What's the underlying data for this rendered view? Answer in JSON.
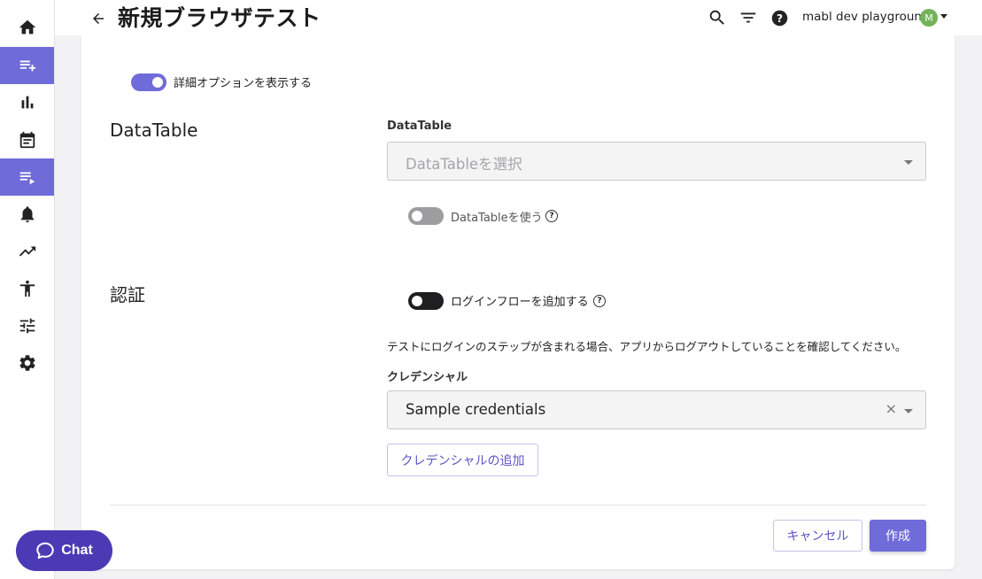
{
  "header": {
    "title": "新規ブラウザテスト",
    "workspace": "mabl dev playground",
    "avatar_initial": "M"
  },
  "sidebar": {
    "items": [
      {
        "icon": "home-icon",
        "active": false
      },
      {
        "icon": "playlist-add-icon",
        "active": true
      },
      {
        "icon": "bar-chart-icon",
        "active": false
      },
      {
        "icon": "calendar-icon",
        "active": false
      },
      {
        "icon": "playlist-play-icon",
        "active": true
      },
      {
        "icon": "bell-icon",
        "active": false
      },
      {
        "icon": "trending-up-icon",
        "active": false
      },
      {
        "icon": "accessibility-icon",
        "active": false
      },
      {
        "icon": "tune-icon",
        "active": false
      },
      {
        "icon": "gear-icon",
        "active": false
      }
    ]
  },
  "form": {
    "advanced_toggle_label": "詳細オプションを表示する",
    "datatable": {
      "section_title": "DataTable",
      "field_label": "DataTable",
      "placeholder": "DataTableを選択",
      "use_toggle_label": "DataTableを使う"
    },
    "auth": {
      "section_title": "認証",
      "login_toggle_label": "ログインフローを追加する",
      "note": "テストにログインのステップが含まれる場合、アプリからログアウトしていることを確認してください。",
      "credential_label": "クレデンシャル",
      "credential_value": "Sample credentials",
      "add_credential_button": "クレデンシャルの追加"
    },
    "cancel_button": "キャンセル",
    "create_button": "作成"
  },
  "chat": {
    "label": "Chat"
  },
  "colors": {
    "accent": "#6f6bd8",
    "chat": "#4a3bb5",
    "avatar": "#73b35a"
  }
}
